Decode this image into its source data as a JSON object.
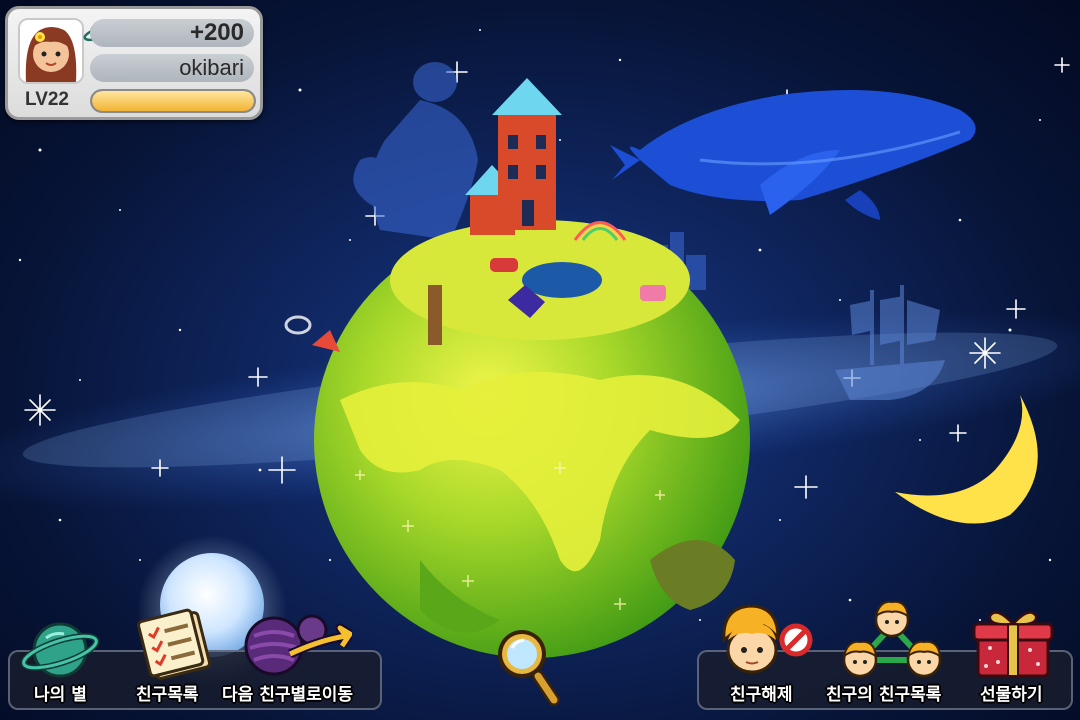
{
  "profile": {
    "points": "+200",
    "username": "okibari",
    "level": "LV22",
    "xp_progress": 1.0
  },
  "left_menu": {
    "my_star": "나의 별",
    "friend_list": "친구목록",
    "next_friend_star": "다음 친구별로이동"
  },
  "right_menu": {
    "unfriend": "친구해제",
    "friends_of_friend": "친구의 친구목록",
    "send_gift": "선물하기"
  },
  "colors": {
    "planet_green": "#7cc61e",
    "planet_yellow": "#e8f040",
    "whale_blue": "#1d4fd6",
    "moon_yellow": "#ffe24a",
    "xp_orange": "#f2b434"
  }
}
